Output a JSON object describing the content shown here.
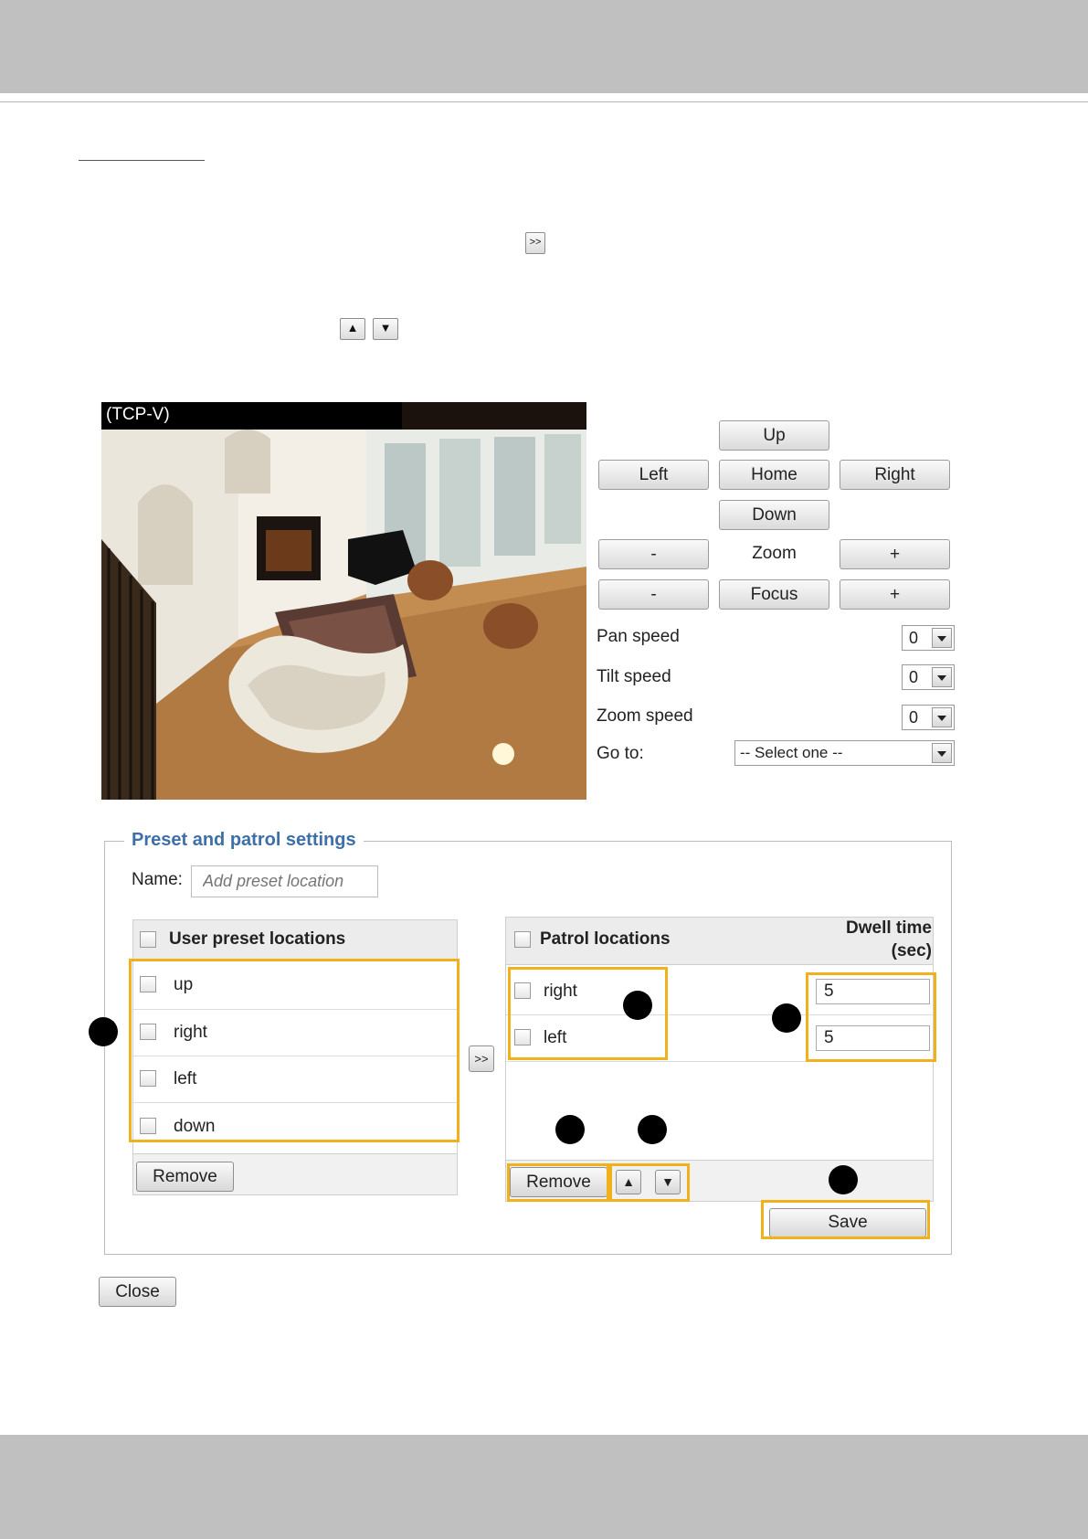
{
  "instruction": {
    "add_button_glyph": ">>",
    "move_up_glyph": "▲",
    "move_down_glyph": "▼"
  },
  "camera": {
    "label": "(TCP-V)"
  },
  "ptz": {
    "up": "Up",
    "left": "Left",
    "home": "Home",
    "right": "Right",
    "down": "Down",
    "zoom_out": "-",
    "zoom_label": "Zoom",
    "zoom_in": "+",
    "focus_near": "-",
    "focus_label": "Focus",
    "focus_far": "+",
    "pan_speed_label": "Pan speed",
    "pan_speed_value": "0",
    "tilt_speed_label": "Tilt speed",
    "tilt_speed_value": "0",
    "zoom_speed_label": "Zoom speed",
    "zoom_speed_value": "0",
    "goto_label": "Go to:",
    "goto_value": "-- Select one --"
  },
  "preset_settings": {
    "legend": "Preset and patrol settings",
    "name_label": "Name:",
    "name_placeholder": "Add preset location",
    "user_presets": {
      "header": "User preset locations",
      "items": [
        "up",
        "right",
        "left",
        "down"
      ],
      "remove_label": "Remove"
    },
    "add_label": ">>",
    "patrol": {
      "header": "Patrol locations",
      "dwell_header_line1": "Dwell time",
      "dwell_header_line2": "(sec)",
      "items": [
        {
          "name": "right",
          "dwell": "5"
        },
        {
          "name": "left",
          "dwell": "5"
        }
      ],
      "remove_label": "Remove",
      "up_label": "▲",
      "down_label": "▼",
      "save_label": "Save"
    }
  },
  "close_label": "Close",
  "colors": {
    "highlight": "#f1b11d",
    "legend": "#3d6fa8",
    "band": "#bfc0bf"
  }
}
